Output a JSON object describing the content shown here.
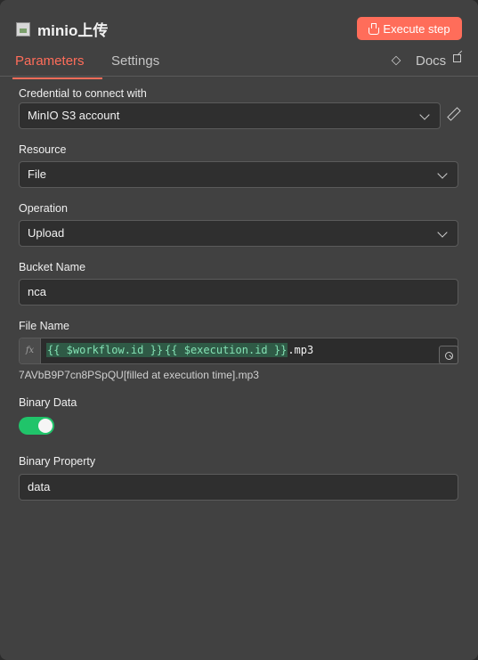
{
  "header": {
    "title": "minio上传",
    "execute_label": "Execute step"
  },
  "tabs": {
    "parameters": "Parameters",
    "settings": "Settings",
    "docs": "Docs"
  },
  "fields": {
    "credential": {
      "label": "Credential to connect with",
      "value": "MinIO S3 account"
    },
    "resource": {
      "label": "Resource",
      "value": "File"
    },
    "operation": {
      "label": "Operation",
      "value": "Upload"
    },
    "bucket": {
      "label": "Bucket Name",
      "value": "nca"
    },
    "file_name": {
      "label": "File Name",
      "fx": "fx",
      "token1": "{{ $workflow.id }}",
      "token2": "{{ $execution.id }}",
      "suffix": ".mp3",
      "preview": "7AVbB9P7cn8PSpQU[filled at execution time].mp3"
    },
    "binary_data": {
      "label": "Binary Data",
      "enabled": true
    },
    "binary_property": {
      "label": "Binary Property",
      "value": "data"
    }
  },
  "icons": {
    "node": "broken-image-icon",
    "execute": "flask-icon",
    "docs": "external-link-icon",
    "credential_edit": "pencil-icon",
    "expression": "fx-icon"
  },
  "colors": {
    "accent": "#ff6d5a",
    "toggle_on": "#20c46a",
    "expression_token": "#83e0b3"
  }
}
